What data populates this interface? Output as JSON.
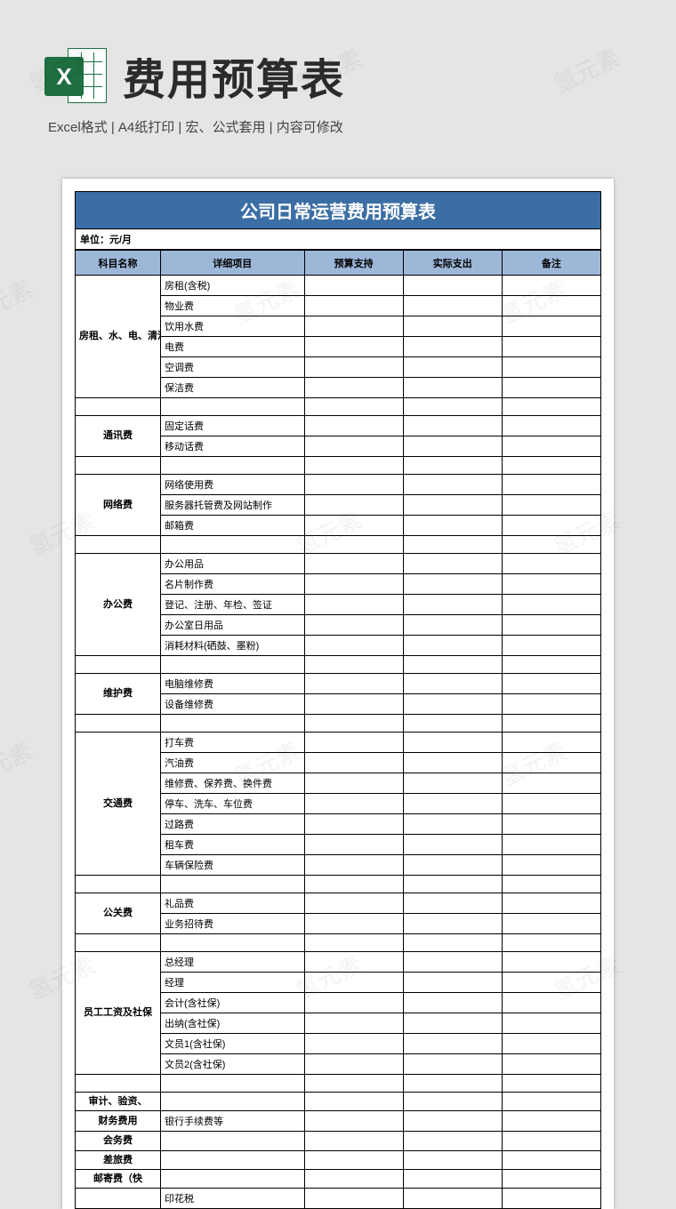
{
  "header": {
    "title": "费用预算表",
    "subtitle": "Excel格式 |  A4纸打印 | 宏、公式套用 | 内容可修改",
    "icon_letter": "X"
  },
  "watermark": "氢元素",
  "sheet": {
    "title": "公司日常运营费用预算表",
    "unit": "单位：元/月",
    "columns": [
      "科目名称",
      "详细项目",
      "预算支持",
      "实际支出",
      "备注"
    ],
    "sections": [
      {
        "category": "房租、水、电、清洁费",
        "items": [
          "房租(含税)",
          "物业费",
          "饮用水费",
          "电费",
          "空调费",
          "保洁费"
        ]
      },
      {
        "category": "通讯费",
        "items": [
          "固定话费",
          "移动话费"
        ]
      },
      {
        "category": "网络费",
        "items": [
          "网络使用费",
          "服务器托管费及网站制作",
          "邮箱费"
        ]
      },
      {
        "category": "办公费",
        "items": [
          "办公用品",
          "名片制作费",
          "登记、注册、年检、签证",
          "办公室日用品",
          "消耗材料(硒鼓、墨粉)"
        ]
      },
      {
        "category": "维护费",
        "items": [
          "电脑维修费",
          "设备维修费"
        ]
      },
      {
        "category": "交通费",
        "items": [
          "打车费",
          "汽油费",
          "维修费、保养费、换件费",
          "停车、洗车、车位费",
          "过路费",
          "租车费",
          "车辆保险费"
        ]
      },
      {
        "category": "公关费",
        "items": [
          "礼品费",
          "业务招待费"
        ]
      },
      {
        "category": "员工工资及社保",
        "items": [
          "总经理",
          "经理",
          "会计(含社保)",
          "出纳(含社保)",
          "文员1(含社保)",
          "文员2(含社保)"
        ]
      },
      {
        "category": "审计、验资、",
        "items": [
          ""
        ]
      },
      {
        "category": "财务费用",
        "items": [
          "银行手续费等"
        ]
      },
      {
        "category": "会务费",
        "items": [
          ""
        ]
      },
      {
        "category": "差旅费",
        "items": [
          ""
        ]
      },
      {
        "category": "邮寄费（快",
        "items": [
          ""
        ]
      },
      {
        "category": "",
        "items": [
          "印花税"
        ]
      }
    ]
  }
}
